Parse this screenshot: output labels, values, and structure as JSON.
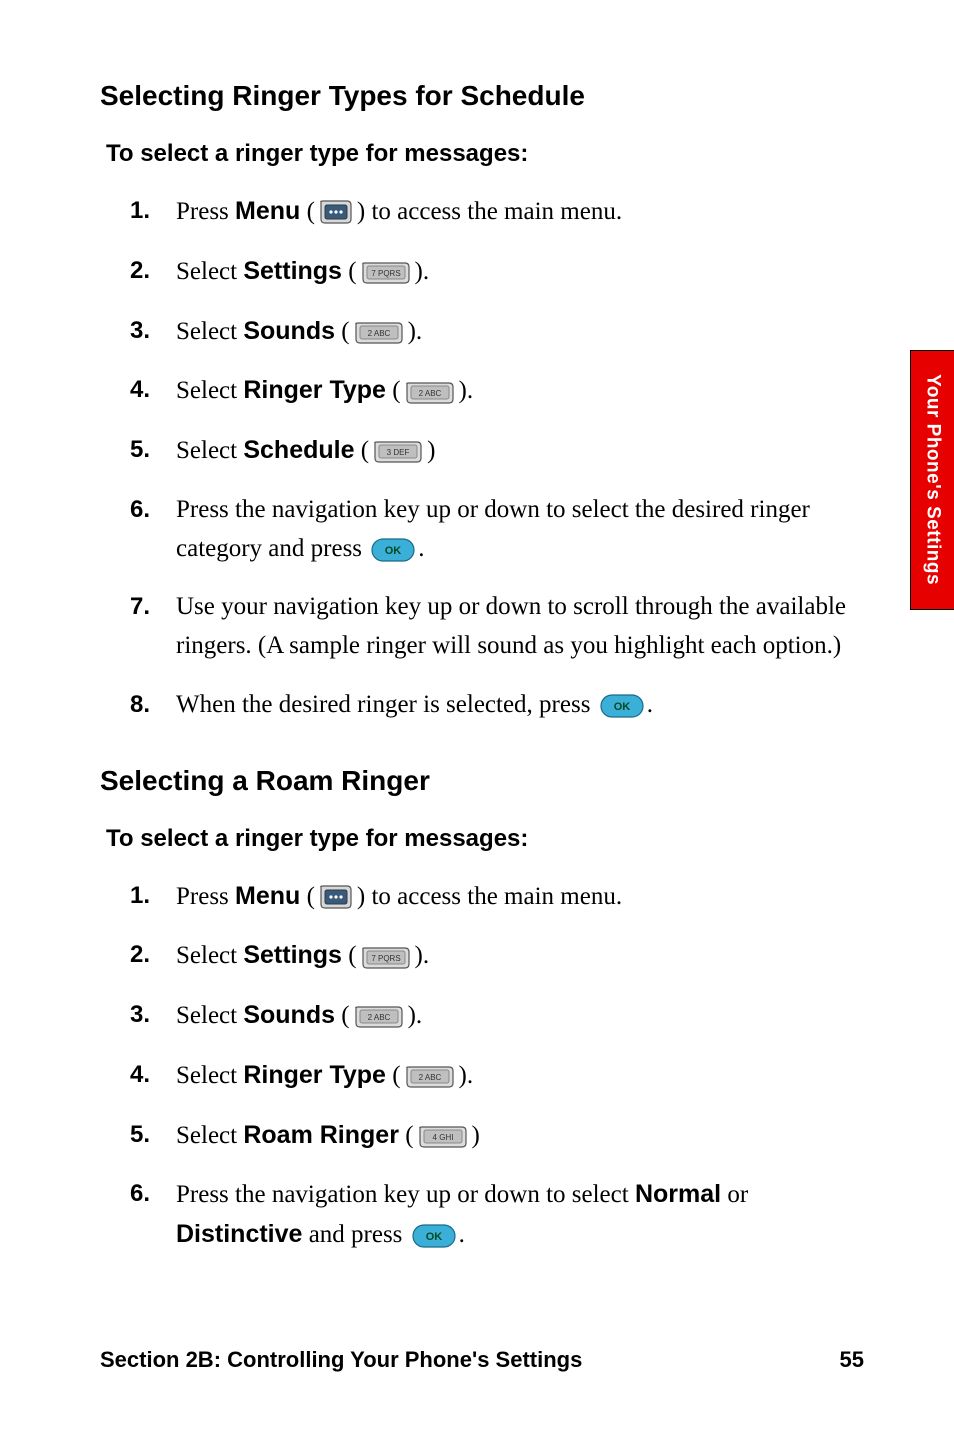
{
  "sideTab": "Your Phone's Settings",
  "section1": {
    "heading": "Selecting Ringer Types for Schedule",
    "sub": "To select a ringer type for messages:",
    "steps": {
      "s1a": "Press ",
      "s1b": "Menu",
      "s1c": " (",
      "s1d": ") to access the main menu.",
      "s2a": "Select ",
      "s2b": "Settings",
      "s2c": " (",
      "s2d": ").",
      "s3a": "Select ",
      "s3b": "Sounds",
      "s3c": " (",
      "s3d": ").",
      "s4a": "Select ",
      "s4b": "Ringer Type",
      "s4c": " (",
      "s4d": ").",
      "s5a": "Select ",
      "s5b": "Schedule",
      "s5c": " (",
      "s5d": ")",
      "s6a": "Press the navigation key up or down to select the desired ringer category and press ",
      "s6b": ".",
      "s7": "Use your navigation key up or down to scroll through the available ringers. (A sample ringer will sound as you highlight each option.)",
      "s8a": "When the desired ringer is selected, press ",
      "s8b": "."
    }
  },
  "section2": {
    "heading": "Selecting a Roam Ringer",
    "sub": "To select a ringer type for messages:",
    "steps": {
      "s1a": "Press ",
      "s1b": "Menu",
      "s1c": " (",
      "s1d": ") to access the main menu.",
      "s2a": "Select ",
      "s2b": "Settings",
      "s2c": " (",
      "s2d": ").",
      "s3a": "Select ",
      "s3b": "Sounds",
      "s3c": " (",
      "s3d": ").",
      "s4a": "Select ",
      "s4b": "Ringer Type",
      "s4c": " (",
      "s4d": ").",
      "s5a": "Select ",
      "s5b": "Roam Ringer",
      "s5c": " (",
      "s5d": ")",
      "s6a": "Press the navigation key up or down to select ",
      "s6b": "Normal",
      "s6c": " or ",
      "s6d": "Distinctive",
      "s6e": " and press ",
      "s6f": "."
    }
  },
  "footer": {
    "left": "Section 2B: Controlling Your Phone's Settings",
    "right": "55"
  },
  "keys": {
    "menu": "Menu key",
    "k7": "7 PQRS",
    "k2": "2 ABC",
    "k3": "3 DEF",
    "k4": "4 GHI",
    "ok": "OK"
  }
}
